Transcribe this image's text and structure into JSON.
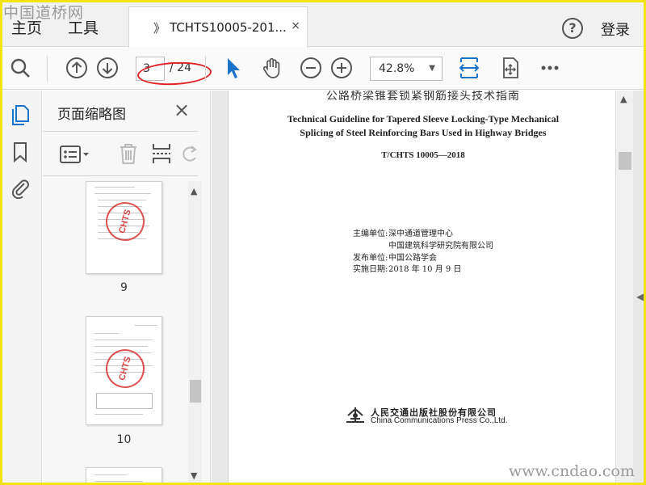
{
  "watermark": {
    "top": "中国道桥网",
    "bottom": "www.cndao.com"
  },
  "menu": {
    "home": "主页",
    "tools": "工具"
  },
  "tab": {
    "arrow": "》",
    "title": "TCHTS10005-201...",
    "close": "×"
  },
  "header": {
    "help": "?",
    "login": "登录"
  },
  "toolbar": {
    "icons": [
      "search-icon",
      "arrow-up-icon",
      "arrow-down-icon",
      "pointer-icon",
      "hand-icon",
      "zoom-out-icon",
      "zoom-in-icon",
      "fit-width-icon",
      "rotate-view-icon",
      "more-icon"
    ],
    "current_page": "3",
    "total_pages": "/ 24",
    "zoom": "42.8%",
    "accent": "#1a73c9",
    "annotation_color": "#dd2222"
  },
  "sidebar": {
    "title": "页面缩略图",
    "close": "×",
    "thumbnails": [
      {
        "label": "9",
        "stamp": "CHTS"
      },
      {
        "label": "10",
        "stamp": "CHTS"
      }
    ]
  },
  "document": {
    "cn_title": "公路桥梁锥套锁紧钢筋接头技术指南",
    "en_title_line1": "Technical Guideline for Tapered Sleeve Locking-Type Mechanical",
    "en_title_line2": "Splicing of Steel Reinforcing Bars Used in Highway Bridges",
    "standard_no": "T/CHTS  10005—2018",
    "editor_label": "主编单位:",
    "editor_1": "深中通道管理中心",
    "editor_2": "中国建筑科学研究院有限公司",
    "issuer_label": "发布单位:",
    "issuer": "中国公路学会",
    "date_label": "实施日期:",
    "date": "2018 年 10 月 9 日",
    "publisher_cn": "人民交通出版社股份有限公司",
    "publisher_en": "China Communications Press  Co.,Ltd."
  }
}
